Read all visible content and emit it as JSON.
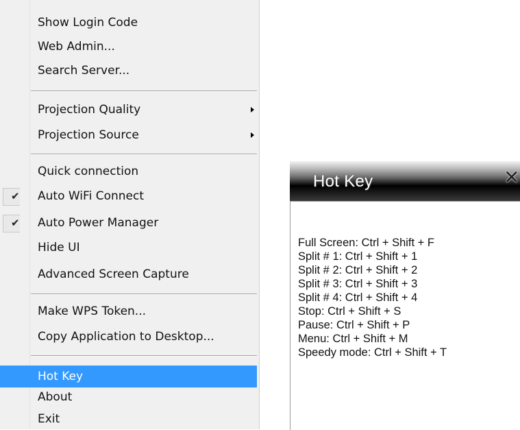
{
  "menu": {
    "items": [
      {
        "label": "Show Login Code",
        "checked": false,
        "submenu": false,
        "selected": false
      },
      {
        "label": "Web Admin...",
        "checked": false,
        "submenu": false,
        "selected": false
      },
      {
        "label": "Search Server...",
        "checked": false,
        "submenu": false,
        "selected": false
      },
      {
        "label": "Projection Quality",
        "checked": false,
        "submenu": true,
        "selected": false
      },
      {
        "label": "Projection Source",
        "checked": false,
        "submenu": true,
        "selected": false
      },
      {
        "label": "Quick connection",
        "checked": false,
        "submenu": false,
        "selected": false
      },
      {
        "label": "Auto WiFi Connect",
        "checked": true,
        "submenu": false,
        "selected": false
      },
      {
        "label": "Auto Power Manager",
        "checked": true,
        "submenu": false,
        "selected": false
      },
      {
        "label": "Hide UI",
        "checked": false,
        "submenu": false,
        "selected": false
      },
      {
        "label": "Advanced Screen Capture",
        "checked": false,
        "submenu": false,
        "selected": false
      },
      {
        "label": "Make WPS Token...",
        "checked": false,
        "submenu": false,
        "selected": false
      },
      {
        "label": "Copy Application to Desktop...",
        "checked": false,
        "submenu": false,
        "selected": false
      },
      {
        "label": "Hot Key",
        "checked": false,
        "submenu": false,
        "selected": true
      },
      {
        "label": "About",
        "checked": false,
        "submenu": false,
        "selected": false
      },
      {
        "label": "Exit",
        "checked": false,
        "submenu": false,
        "selected": false
      }
    ],
    "check_glyph": "✔",
    "selected_color": "#3399ff"
  },
  "hotkey_window": {
    "title": "Hot Key",
    "close_glyph": "✕",
    "lines": [
      "Full Screen: Ctrl + Shift + F",
      "Split # 1: Ctrl + Shift + 1",
      "Split # 2: Ctrl + Shift + 2",
      "Split # 3: Ctrl + Shift + 3",
      "Split # 4: Ctrl + Shift + 4",
      "Stop:  Ctrl + Shift + S",
      "Pause:  Ctrl + Shift + P",
      "Menu: Ctrl + Shift + M",
      "Speedy mode:  Ctrl + Shift + T"
    ]
  }
}
